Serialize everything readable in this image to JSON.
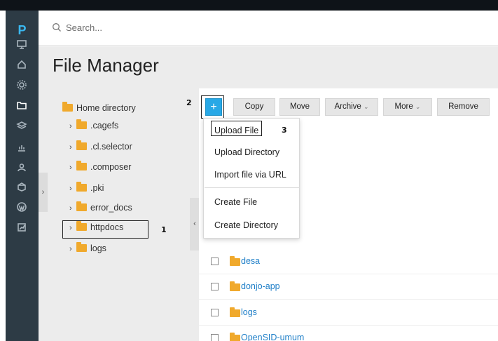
{
  "search": {
    "placeholder": "Search..."
  },
  "sidebar": {
    "logo": "P",
    "icons": [
      "monitor-icon",
      "home-icon",
      "gear-icon",
      "folder-icon",
      "layers-icon",
      "chart-icon",
      "user-icon",
      "package-icon",
      "wordpress-icon",
      "stats-icon"
    ]
  },
  "page": {
    "title": "File Manager"
  },
  "tree": {
    "root": "Home directory",
    "items": [
      ".cagefs",
      ".cl.selector",
      ".composer",
      ".pki",
      "error_docs",
      "httpdocs",
      "logs"
    ]
  },
  "toolbar": {
    "add": "+",
    "copy": "Copy",
    "move": "Move",
    "archive": "Archive",
    "more": "More",
    "remove": "Remove"
  },
  "dropdown": {
    "items": [
      "Upload File",
      "Upload Directory",
      "Import file via URL",
      "Create File",
      "Create Directory"
    ]
  },
  "files": [
    "desa",
    "donjo-app",
    "logs",
    "OpenSID-umum"
  ],
  "callouts": {
    "one": "1",
    "two": "2",
    "three": "3"
  },
  "colors": {
    "accent": "#28a8e6",
    "sidebar": "#2d3b45",
    "folder": "#f0a92c",
    "link": "#1f7fc8"
  }
}
